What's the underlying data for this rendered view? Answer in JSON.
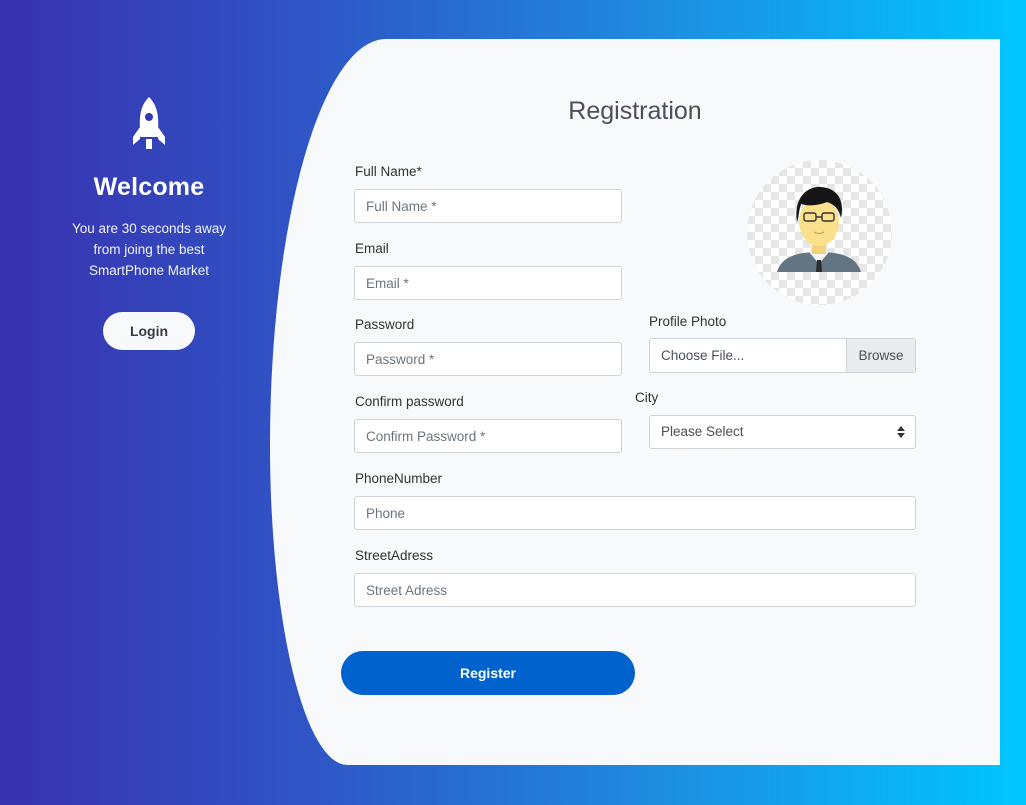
{
  "welcome": {
    "title": "Welcome",
    "line1": "You are 30 seconds away",
    "line2": "from joing the best",
    "line3": "SmartPhone Market",
    "login_label": "Login"
  },
  "form": {
    "title": "Registration",
    "full_name": {
      "label": "Full Name*",
      "placeholder": "Full Name *"
    },
    "email": {
      "label": "Email",
      "placeholder": "Email *"
    },
    "password": {
      "label": "Password",
      "placeholder": "Password *"
    },
    "confirm_password": {
      "label": "Confirm password",
      "placeholder": "Confirm Password *"
    },
    "profile_photo": {
      "label": "Profile Photo",
      "file_text": "Choose File...",
      "browse_label": "Browse"
    },
    "city": {
      "label": "City",
      "selected": "Please Select"
    },
    "phone": {
      "label": "PhoneNumber",
      "placeholder": "Phone"
    },
    "street": {
      "label": "StreetAdress",
      "placeholder": "Street Adress"
    },
    "register_label": "Register"
  },
  "colors": {
    "gradient_start": "#3931af",
    "gradient_end": "#00c6ff",
    "register_button": "#0062cc",
    "card_background": "#f8f9fa"
  },
  "icons": {
    "welcome_icon": "rocket-icon",
    "select_icon": "sort-arrows-icon",
    "avatar_icon": "user-avatar-icon"
  }
}
